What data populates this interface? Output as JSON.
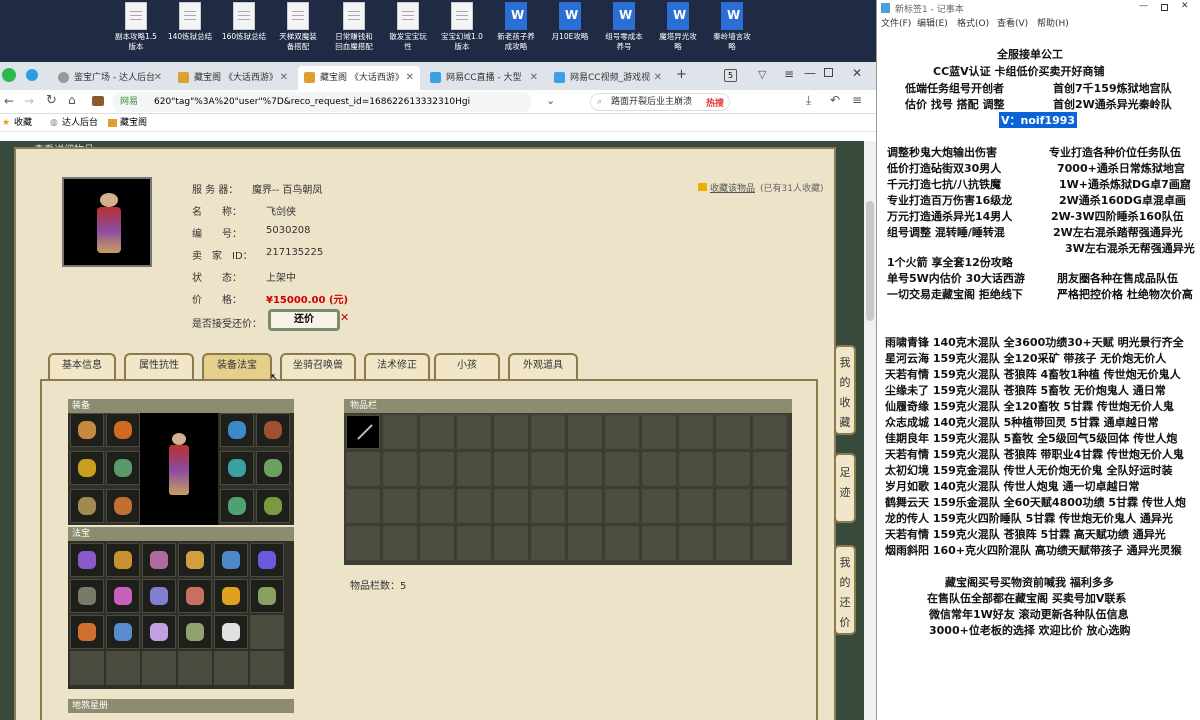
{
  "desktop": {
    "icons": [
      {
        "l1": "副本攻略1.5",
        "l2": "版本",
        "w": false
      },
      {
        "l1": "140炼狱总结",
        "l2": "",
        "w": false
      },
      {
        "l1": "160炼狱总结",
        "l2": "",
        "w": false
      },
      {
        "l1": "天梯双魔装",
        "l2": "备搭配",
        "w": false
      },
      {
        "l1": "日常赚钱和",
        "l2": "回血魔搭配",
        "w": false
      },
      {
        "l1": "散发宝宝玩",
        "l2": "性",
        "w": false
      },
      {
        "l1": "宝宝幻域1.0",
        "l2": "版本",
        "w": false
      },
      {
        "l1": "新老孩子养",
        "l2": "成攻略",
        "w": true
      },
      {
        "l1": "月10E攻略",
        "l2": "",
        "w": true
      },
      {
        "l1": "组号零成本",
        "l2": "养号",
        "w": true
      },
      {
        "l1": "魔塔异光攻",
        "l2": "略",
        "w": true
      },
      {
        "l1": "秦岭墙言攻",
        "l2": "略",
        "w": true
      }
    ]
  },
  "browser": {
    "tabs": [
      "鉴宝广场 - 达人后台",
      "藏宝阁 《大话西游》",
      "藏宝阁 《大话西游》",
      "网易CC直播 - 大型",
      "网易CC视频_游戏视"
    ],
    "tab_count": "5",
    "address": "620\"tag\"%3A%20\"user\"%7D&reco_request_id=168622613332310Hgi",
    "address_prefix": "网易",
    "search_placeholder": "路面开裂后业主崩溃",
    "hot": "热搜",
    "bookmarks": [
      "收藏",
      "达人后台",
      "藏宝阁"
    ]
  },
  "item": {
    "view_detail": "查看详细物品",
    "fav_link": "收藏该物品",
    "fav_count": "(已有31人收藏)",
    "server_label": "服 务 器：",
    "server": "魔界-- 百鸟朝凤",
    "name_label": "名　　称：",
    "name": "飞剑侠",
    "id_label": "编　　号：",
    "id": "5030208",
    "seller_label": "卖　家　ID：",
    "seller": "217135225",
    "status_label": "状　　态：",
    "status": "上架中",
    "price_label": "价　　格：",
    "price": "¥15000.00 (元)",
    "bargain_label": "是否接受还价：",
    "bargain_btn": "还价",
    "tabs": [
      "基本信息",
      "属性抗性",
      "装备法宝",
      "坐骑召唤兽",
      "法术修正",
      "小孩",
      "外观道具"
    ],
    "equip_title": "装备",
    "fabao_title": "法宝",
    "xingpan_title": "地煞星册",
    "bag_title": "物品栏",
    "bag_count_label": "物品栏数：",
    "bag_count": "5",
    "side_buttons": [
      "我的收藏",
      "足迹",
      "我的还价"
    ]
  },
  "notepad": {
    "title": "新标签1 - 记事本",
    "menu": [
      "文件(F)",
      "编辑(E)",
      "格式(O)",
      "查看(V)",
      "帮助(H)"
    ],
    "header1": "全服接单公工",
    "header2": "CC蓝V认证 卡组低价买卖开好商铺",
    "line_a1": "低端任务组号开创者",
    "line_a2": "首创7千159炼狱地宫队",
    "line_b1": "估价 找号 搭配 调整",
    "line_b2": "首创2W通杀异光秦岭队",
    "contact": "V：noif1993",
    "col_left": [
      "调整秒鬼大炮输出伤害",
      "低价打造砧街双30男人",
      "千元打造七抗/八抗铁魔",
      "专业打造百万伤害16级龙",
      "万元打造通杀异光14男人",
      "组号调整 混转睡/睡转混"
    ],
    "col_right": [
      "专业打造各种价位任务队伍",
      "7000+通杀日常炼狱地宫",
      "1W+通杀炼狱DG卓7画窟",
      "2W通杀160DG卓混卓画",
      "2W-3W四阶睡杀160队伍",
      "2W左右混杀踏帮强通异光",
      "3W左右混杀无帮强通异光"
    ],
    "promo": [
      "1个火箭 享全套12份攻略",
      "单号5W内估价 30大话西游",
      "一切交易走藏宝阁 拒绝线下"
    ],
    "promo_right": [
      "朋友圈各种在售成品队伍",
      "严格把控价格 杜绝物次价高"
    ],
    "teams": [
      "雨啸青锋 140克木混队 全3600功绩30+天赋 明光景行齐全",
      "星河云海 159克火混队 全120采矿 带孩子 无价炮无价人",
      "天若有情 159克火混队 苍狼阵 4畜牧1种植 传世炮无价鬼人",
      "尘缘未了 159克火混队 苍狼阵 5畜牧 无价炮鬼人 通日常",
      "仙履奇缘 159克火混队 全120畜牧 5甘霖 传世炮无价人鬼",
      "众志成城 140克火混队 5种植带回灵 5甘霖 通卓越日常",
      "佳期良年 159克火混队 5畜牧 全5级回气5级回体 传世人炮",
      "天若有情 159克火混队 苍狼阵 带职业4甘霖 传世炮无价人鬼",
      "太初幻境 159克金混队 传世人无价炮无价鬼 全队好运时装",
      "岁月如歌 140克火混队 传世人炮鬼 通一切卓越日常",
      "鹤舞云天 159乐金混队 全60天赋4800功绩 5甘霖 传世人炮",
      "龙的传人 159克火四阶睡队 5甘霖 传世炮无价鬼人 通异光",
      "天若有情 159克火混队 苍狼阵 5甘霖 高天赋功绩 通异光",
      "烟雨斜阳 160+克火四阶混队 高功绩天赋带孩子 通异光灵猴"
    ],
    "footer": [
      "藏宝阁买号买物资前喊我 福利多多",
      "在售队伍全部都在藏宝阁 买卖号加V联系",
      "微信常年1W好友 滚动更新各种队伍信息",
      "3000+位老板的选择 欢迎比价 放心选购"
    ]
  }
}
